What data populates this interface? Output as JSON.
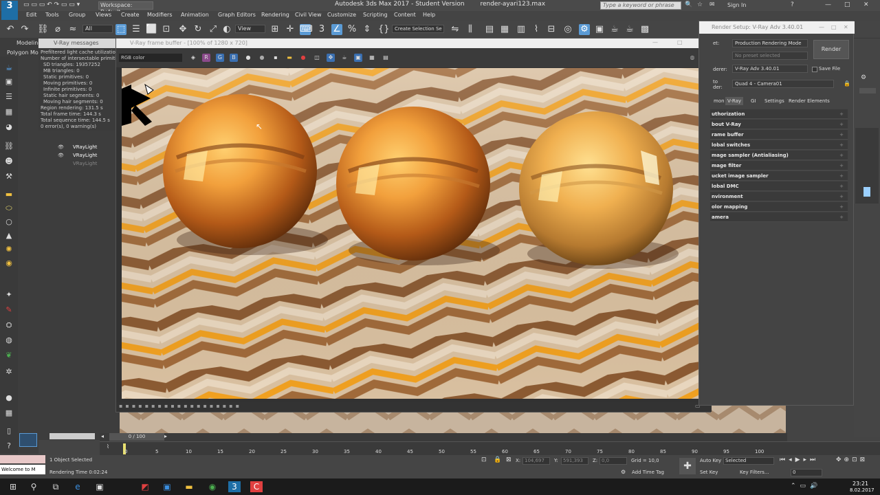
{
  "titlebar": {
    "app_letter": "3",
    "title": "Autodesk 3ds Max 2017 - Student Version        render-ayari123.max",
    "workspace": "Workspace: Default",
    "search_placeholder": "Type a keyword or phrase",
    "signin": "Sign In",
    "win_min": "—",
    "win_max": "□",
    "win_close": "✕"
  },
  "menu": [
    "Edit",
    "Tools",
    "Group",
    "Views",
    "Create",
    "Modifiers",
    "Animation",
    "Graph Editors",
    "Rendering",
    "Civil View",
    "Customize",
    "Scripting",
    "Content",
    "Help"
  ],
  "toolbar": {
    "selection_filter": "All",
    "view_dropdown": "View",
    "create_selection_set": "Create Selection Se"
  },
  "ribbon": {
    "tab_modeling": "Modeling",
    "tab_polygon": "Polygon Mod"
  },
  "vray_messages": {
    "title": "V-Ray messages",
    "lines": [
      "Prefiltered light cache utilization",
      "Number of intersectable primitives:",
      "SD triangles: 19357252",
      "MB triangles: 0",
      "Static primitives: 0",
      "Moving primitives: 0",
      "Infinite primitives: 0",
      "Static hair segments: 0",
      "Moving hair segments: 0",
      "Region rendering: 131.5 s",
      "Total frame time: 144.3 s",
      "Total sequence time: 144.5 s",
      "0 error(s), 0 warning(s)"
    ]
  },
  "scene_explorer": {
    "items": [
      "VRayLight",
      "VRayLight",
      "VRayLight"
    ]
  },
  "frame_buffer": {
    "title": "V-Ray frame buffer - [100% of 1280 x 720]",
    "channel": "RGB color",
    "r": "R",
    "g": "G",
    "b": "B",
    "win_min": "—",
    "win_max": "□",
    "win_close": "✕"
  },
  "render_setup": {
    "title": "Render Setup: V-Ray Adv 3.40.01",
    "target_label": "et:",
    "target_value": "Production Rendering Mode",
    "preset_value": "No preset selected",
    "renderer_label": "derer:",
    "renderer_value": "V-Ray Adv 3.40.01",
    "save_file": "Save File",
    "view_label": "to\nder:",
    "view_value": "Quad 4 - Camera01",
    "render_button": "Render",
    "tabs": [
      "mon",
      "V-Ray",
      "GI",
      "Settings",
      "Render Elements"
    ],
    "rollouts": [
      "uthorization",
      "bout V-Ray",
      "rame buffer",
      "lobal switches",
      "mage sampler (Antialiasing)",
      "mage filter",
      "ucket image sampler",
      "lobal DMC",
      "nvironment",
      "olor mapping",
      "amera"
    ]
  },
  "timeline": {
    "counter": "0 / 100",
    "ticks": [
      "0",
      "5",
      "10",
      "15",
      "20",
      "25",
      "30",
      "35",
      "40",
      "45",
      "50",
      "55",
      "60",
      "65",
      "70",
      "75",
      "80",
      "85",
      "90",
      "95",
      "100"
    ]
  },
  "status": {
    "maxscript": "Welcome to M",
    "selected": "1 Object Selected",
    "render_time": "Rendering Time  0:02:24",
    "x_label": "X:",
    "x_value": "104,697",
    "y_label": "Y:",
    "y_value": "591,393",
    "z_label": "Z:",
    "z_value": "0,0",
    "grid": "Grid = 10,0",
    "add_time_tag": "Add Time Tag",
    "auto_key": "Auto Key",
    "set_key": "Set Key",
    "key_mode": "Selected",
    "key_filters": "Key Filters...",
    "frame": "0"
  },
  "taskbar": {
    "time": "23:21",
    "date": "8.02.2017"
  },
  "colors": {
    "accent": "#5b9bd5",
    "app_bg": "#444444",
    "max_blue": "#1e6ea6"
  }
}
